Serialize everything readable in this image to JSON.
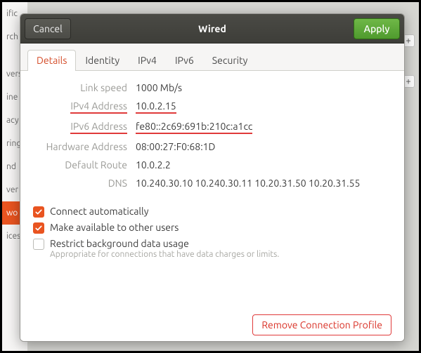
{
  "bg": {
    "items": [
      "ific",
      "rch",
      "",
      "vers",
      "ine",
      "acy",
      "ring",
      "nd",
      "ver",
      "wo",
      "ices"
    ],
    "selected_index": 9
  },
  "titlebar": {
    "cancel": "Cancel",
    "title": "Wired",
    "apply": "Apply"
  },
  "tabs": [
    "Details",
    "Identity",
    "IPv4",
    "IPv6",
    "Security"
  ],
  "active_tab_index": 0,
  "details": {
    "rows": [
      {
        "label": "Link speed",
        "value": "1000 Mb/s",
        "hl_label": false,
        "hl_value": false
      },
      {
        "label": "IPv4 Address",
        "value": "10.0.2.15",
        "hl_label": true,
        "hl_value": true
      },
      {
        "label": "IPv6 Address",
        "value": "fe80::2c69:691b:210c:a1cc",
        "hl_label": true,
        "hl_value": true
      },
      {
        "label": "Hardware Address",
        "value": "08:00:27:F0:68:1D",
        "hl_label": false,
        "hl_value": false
      },
      {
        "label": "Default Route",
        "value": "10.0.2.2",
        "hl_label": false,
        "hl_value": false
      },
      {
        "label": "DNS",
        "value": "10.240.30.10 10.240.30.11 10.20.31.50 10.20.31.55",
        "hl_label": false,
        "hl_value": false
      }
    ],
    "checks": [
      {
        "label": "Connect automatically",
        "sub": "",
        "checked": true
      },
      {
        "label": "Make available to other users",
        "sub": "",
        "checked": true
      },
      {
        "label": "Restrict background data usage",
        "sub": "Appropriate for connections that have data charges or limits.",
        "checked": false
      }
    ]
  },
  "footer": {
    "remove": "Remove Connection Profile"
  }
}
